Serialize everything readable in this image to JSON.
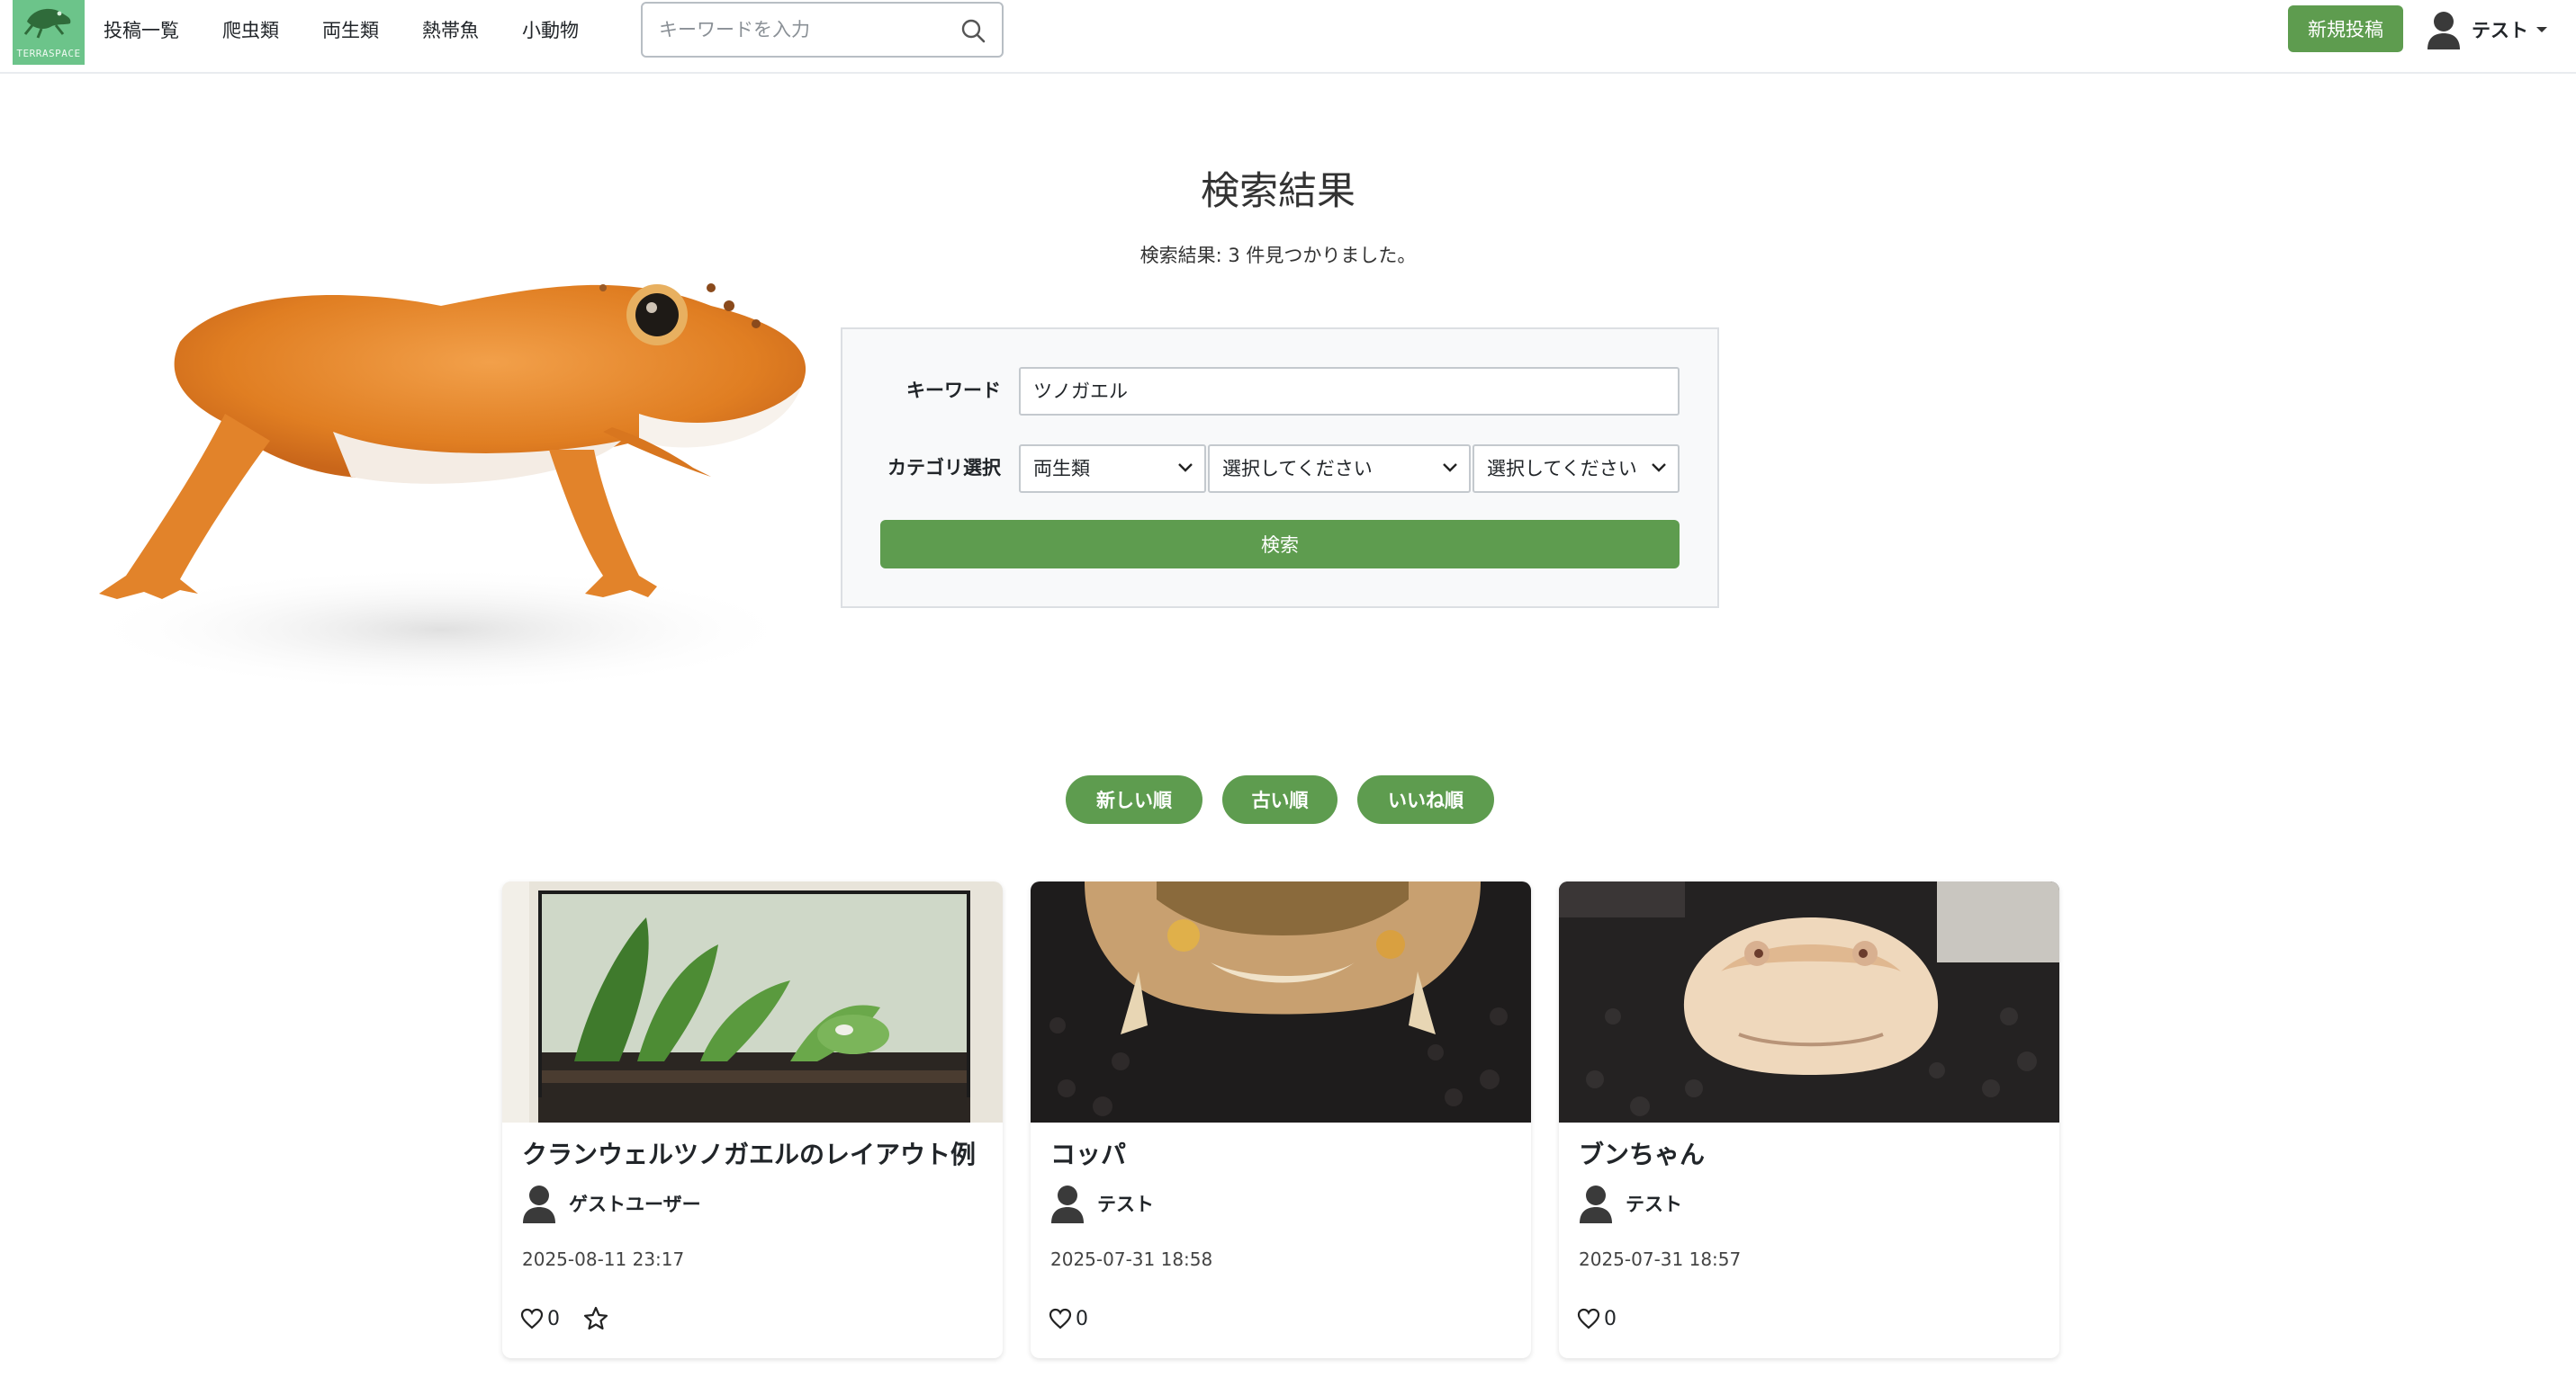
{
  "app": {
    "logo_text": "TERRASPACE"
  },
  "nav": {
    "links": [
      "投稿一覧",
      "爬虫類",
      "両生類",
      "熱帯魚",
      "小動物"
    ],
    "search_placeholder": "キーワードを入力",
    "new_post": "新規投稿",
    "user_name": "テスト"
  },
  "hero": {
    "title": "検索結果",
    "subtitle": "検索結果: 3 件見つかりました。"
  },
  "search_form": {
    "keyword_label": "キーワード",
    "keyword_value": "ツノガエル",
    "category_label": "カテゴリ選択",
    "category1": "両生類",
    "category2": "選択してください",
    "category3": "選択してください",
    "submit": "検索"
  },
  "sort": {
    "newest": "新しい順",
    "oldest": "古い順",
    "likes": "いいね順"
  },
  "posts": [
    {
      "title": "クランウェルツノガエルのレイアウト例",
      "author": "ゲストユーザー",
      "date": "2025-08-11 23:17",
      "likes": "0",
      "has_favorite": true
    },
    {
      "title": "コッパ",
      "author": "テスト",
      "date": "2025-07-31 18:58",
      "likes": "0",
      "has_favorite": false
    },
    {
      "title": "ブンちゃん",
      "author": "テスト",
      "date": "2025-07-31 18:57",
      "likes": "0",
      "has_favorite": false
    }
  ],
  "colors": {
    "primary": "#5e9c4f",
    "logo_bg": "#6cc48a"
  },
  "icons": [
    "search-icon",
    "user-avatar-icon",
    "caret-down-icon",
    "chevron-down-icon",
    "heart-icon",
    "star-icon"
  ]
}
